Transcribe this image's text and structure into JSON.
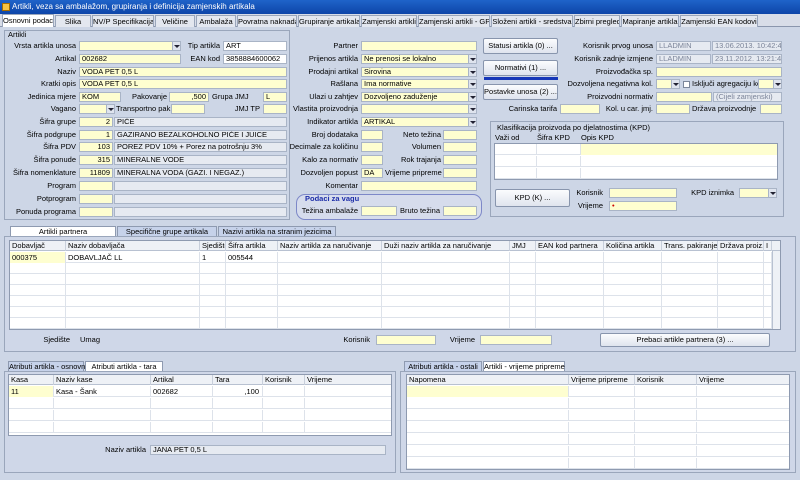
{
  "window": {
    "title": "Artikli, veza sa ambalažom, grupiranja i definicija zamjenskih artikala"
  },
  "tabs": [
    "Osnovni podaci",
    "Slika",
    "NV/P Specifikacija",
    "Veličine",
    "Ambalaža",
    "Povratna naknada",
    "Grupiranje artikala",
    "Zamjenski artikli",
    "Zamjenski artikli - GP",
    "Složeni artikli - sredstva",
    "Zbirni pregled",
    "Mapiranje artikla",
    "Zamjenski EAN kodovi"
  ],
  "artikli": {
    "section": "Artikli",
    "vrsta_label": "Vrsta artikla unosa",
    "vrsta": "",
    "tip_label": "Tip artikla",
    "tip": "ART",
    "artikal_label": "Artikal",
    "artikal": "002682",
    "ean_label": "EAN kod",
    "ean": "3858884600062",
    "naziv_label": "Naziv",
    "naziv": "VODA PET 0,5 L",
    "kratki_label": "Kratki opis",
    "kratki": "VODA PET 0,5 L",
    "jm_label": "Jedinica mjere",
    "jm": "KOM",
    "pak_label": "Pakovanje",
    "pak": ",500",
    "gjm_label": "Grupa JMJ",
    "gjm": "L",
    "vagano_label": "Vagano",
    "vagano": "",
    "transport_label": "Transportno pak.",
    "transport": "",
    "jmjtp_label": "JMJ TP",
    "jmjtp": "",
    "sg_label": "Šifra grupe",
    "sg_code": "2",
    "sg_text": "PIĆE",
    "sp_label": "Šifra podgrupe",
    "sp_code": "1",
    "sp_text": "GAZIRANO BEZALKOHOLNO PIĆE I JUICE",
    "pdv_label": "Šifra PDV",
    "pdv_code": "103",
    "pdv_text": "POREZ PDV 10% + Porez na potrošnju 3%",
    "ponuda_label": "Šifra ponude",
    "ponuda_code": "315",
    "ponuda_text": "MINERALNE VODE",
    "nom_label": "Šifra nomenklature",
    "nom_code": "11809",
    "nom_text": "MINERALNA VODA (GAZI. I NEGAZ.)",
    "program_label": "Program",
    "potprogram_label": "Potprogram",
    "ponuda_prog_label": "Ponuda programa"
  },
  "middle": {
    "partner_label": "Partner",
    "partner": "",
    "prijenos_label": "Prijenos artikla",
    "prijenos": "Ne prenosi se lokalno",
    "prodajni_label": "Prodajni artikal",
    "prodajni": "Sirovina",
    "raslana_label": "Rašlana",
    "raslana": "Ima normative",
    "ulazi_label": "Ulazi u zahtjev",
    "ulazi": "Dozvoljeno zaduženje",
    "vlastita_label": "Vlastita proizvodnja",
    "vlastita": "",
    "indikator_label": "Indikator artikla",
    "indikator": "ARTIKAL",
    "broj_label": "Broj dodataka",
    "neto_label": "Neto težina",
    "decimale_label": "Decimale za količinu",
    "volumen_label": "Volumen",
    "kalo_label": "Kalo za normativ",
    "rok_label": "Rok trajanja",
    "dozvoljen_label": "Dozvoljen popust",
    "dozvoljen": "DA",
    "vrijeme_label": "Vrijeme pripreme",
    "komentar_label": "Komentar",
    "vaga_title": "Podaci za vagu",
    "tezina_amb_label": "Težina ambalaže",
    "bruto_label": "Bruto težina"
  },
  "right": {
    "status_btn": "Statusi artikla (0) ...",
    "normativi_btn": "Normativi (1) ...",
    "postavke_btn": "Postavke unosa (2) ...",
    "kpu_label": "Korisnik prvog unosa",
    "kpu": "LLADMIN",
    "kpu_time": "13.06.2013. 10:42:49",
    "kzi_label": "Korisnik zadnje izmjene",
    "kzi": "LLADMIN",
    "kzi_time": "23.11.2012. 13:21:47",
    "proizv_label": "Proizvođačka sp.",
    "negkol_label": "Dozvoljena negativna kol.",
    "agreg_label": "Isključi agregaciju kol.",
    "proizv_norm_label": "Proizvodni normativ",
    "zamj_label": "(Cijeli zamjenski)",
    "carinska_label": "Carinska tarifa",
    "kol_car_label": "Kol. u car. jmj.",
    "drzava_label": "Država proizvodnje",
    "kpd_title": "Klasifikacija proizvoda po djelatnostima (KPD)",
    "kpd_cols": [
      "Važi od",
      "Šifra KPD",
      "Opis KPD"
    ],
    "kpd_btn": "KPD (K) ...",
    "kpd_korisnik_label": "Korisnik",
    "kpd_iznimka_label": "KPD iznimka",
    "kpd_vrijeme_label": "Vrijeme"
  },
  "partners": {
    "tabs": [
      "Artikli partnera",
      "Specifične grupe artikala",
      "Nazivi artikla na stranim jezicima"
    ],
    "cols": [
      "Dobavljač",
      "Naziv dobavljača",
      "Sjedište",
      "Šifra artikla",
      "Naziv artikla za naručivanje",
      "Duži naziv artikla za naručivanje",
      "JMJ",
      "EAN kod partnera",
      "Količina  artikla",
      "Trans. pakiranje",
      "Država proiz.",
      "I"
    ],
    "rows": [
      [
        "000375",
        "DOBAVLJAČ LL",
        "1",
        "005544",
        "",
        "",
        "",
        "",
        "",
        "",
        "",
        ""
      ]
    ],
    "sjediste_label": "Sjedište",
    "sjediste": "Umag",
    "korisnik_label": "Korisnik",
    "vrijeme_label": "Vrijeme",
    "prebaci_btn": "Prebaci artikle partnera (3) ..."
  },
  "bottom_left": {
    "tabs": [
      "Atributi artikla - osnovni",
      "Atributi artikla - tara"
    ],
    "cols": [
      "Kasa",
      "Naziv kase",
      "Artikal",
      "Tara",
      "Korisnik",
      "Vrijeme"
    ],
    "rows": [
      [
        "11",
        "Kasa - Šank",
        "002682",
        ",100",
        "",
        ""
      ]
    ],
    "naziv_label": "Naziv artikla",
    "naziv": "JANA PET 0,5 L"
  },
  "bottom_right": {
    "tabs": [
      "Atributi artikla - ostali",
      "Artikli - vrijeme pripreme"
    ],
    "cols": [
      "Napomena",
      "Vrijeme pripreme",
      "Korisnik",
      "Vrijeme"
    ]
  }
}
